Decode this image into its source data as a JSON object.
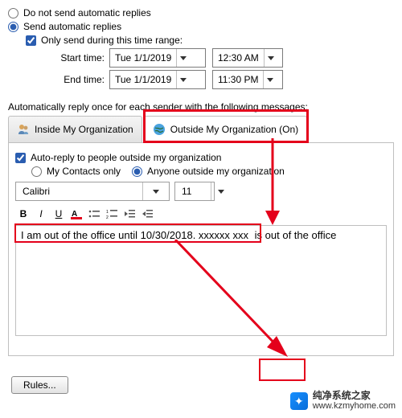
{
  "auto": {
    "no_auto_label": "Do not send automatic replies",
    "auto_label": "Send automatic replies",
    "range_label": "Only send during this time range:",
    "start_label": "Start time:",
    "end_label": "End time:",
    "start_date": "Tue 1/1/2019",
    "start_time": "12:30 AM",
    "end_date": "Tue 1/1/2019",
    "end_time": "11:30 PM"
  },
  "section_label": "Automatically reply once for each sender with the following messages:",
  "tabs": {
    "inside": "Inside My Organization",
    "outside": "Outside My Organization (On)"
  },
  "outside": {
    "auto_outside": "Auto-reply to people outside my organization",
    "contacts_only": "My Contacts only",
    "anyone": "Anyone outside my organization"
  },
  "format": {
    "font": "Calibri",
    "size": "11"
  },
  "message": {
    "part1": "I am out of the office until 10/30/2018. xxxxxx xxx",
    "part2": "is out of the office"
  },
  "footer": {
    "rules": "Rules..."
  },
  "wm": {
    "line1": "纯净系统之家",
    "line2": "www.kzmyhome.com"
  },
  "colors": {
    "accent_red": "#e4001b"
  }
}
